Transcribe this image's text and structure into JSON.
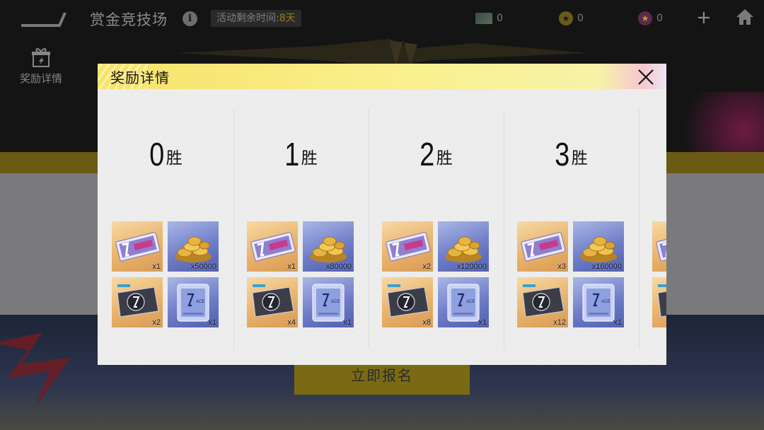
{
  "header": {
    "title": "赏金竞技场",
    "timer_label": "活动剩余时间:",
    "timer_days": "8天",
    "currencies": [
      {
        "icon": "ticket-icon",
        "value": "0"
      },
      {
        "icon": "coin-icon",
        "value": "0"
      },
      {
        "icon": "gem-icon",
        "value": "0"
      }
    ]
  },
  "sidebar": {
    "reward_label": "奖励详情"
  },
  "register_button": "立即报名",
  "modal": {
    "title": "奖励详情",
    "tiers": [
      {
        "num": "0",
        "unit": "胜",
        "items": [
          {
            "type": "ticket",
            "qty": "x1"
          },
          {
            "type": "coins",
            "qty": "x50000"
          },
          {
            "type": "card",
            "qty": "x2"
          },
          {
            "type": "crate",
            "qty": "x1"
          }
        ]
      },
      {
        "num": "1",
        "unit": "胜",
        "items": [
          {
            "type": "ticket",
            "qty": "x1"
          },
          {
            "type": "coins",
            "qty": "x80000"
          },
          {
            "type": "card",
            "qty": "x4"
          },
          {
            "type": "crate",
            "qty": "x1"
          }
        ]
      },
      {
        "num": "2",
        "unit": "胜",
        "items": [
          {
            "type": "ticket",
            "qty": "x2"
          },
          {
            "type": "coins",
            "qty": "x120000"
          },
          {
            "type": "card",
            "qty": "x8"
          },
          {
            "type": "crate",
            "qty": "x1"
          }
        ]
      },
      {
        "num": "3",
        "unit": "胜",
        "items": [
          {
            "type": "ticket",
            "qty": "x3"
          },
          {
            "type": "coins",
            "qty": "x160000"
          },
          {
            "type": "card",
            "qty": "x12"
          },
          {
            "type": "crate",
            "qty": "x1"
          }
        ]
      }
    ]
  },
  "colors": {
    "accent_yellow": "#f7e26a",
    "gold_tile": "#e9b26a",
    "blue_tile": "#6f7dc8",
    "timer_highlight": "#a37b17"
  }
}
